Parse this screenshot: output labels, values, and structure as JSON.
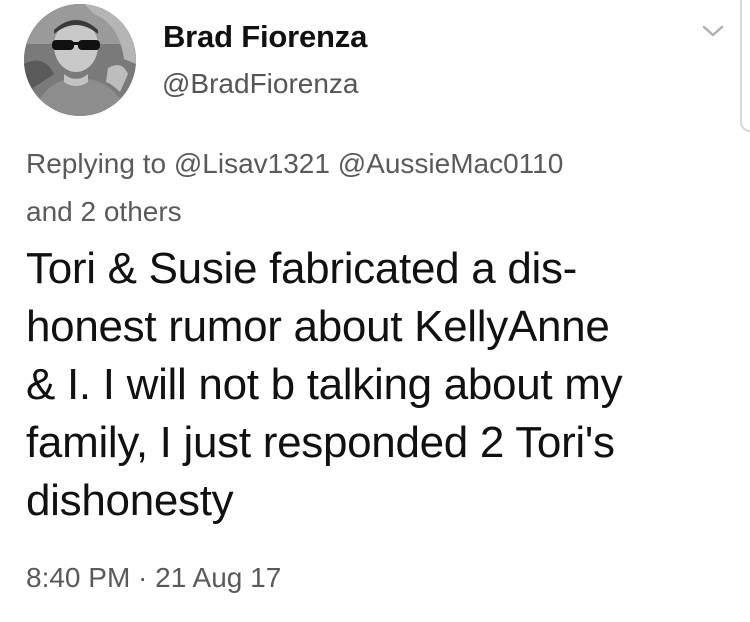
{
  "tweet": {
    "author": {
      "display_name": "Brad Fiorenza",
      "handle": "@BradFiorenza",
      "avatar": "profile-photo-man-sunglasses"
    },
    "menu_icon": "chevron-down-icon",
    "reply_context": {
      "prefix": "Replying to",
      "mentions": [
        "@Lisav1321",
        "@AussieMac0110"
      ],
      "suffix": "and 2 others"
    },
    "text": "Tori & Susie fabricated a dis-\nhonest rumor about KellyAnne\n& I. I will not b talking about my\nfamily, I just responded 2 Tori's\ndishonesty",
    "timestamp": "8:40 PM · 21 Aug 17"
  }
}
